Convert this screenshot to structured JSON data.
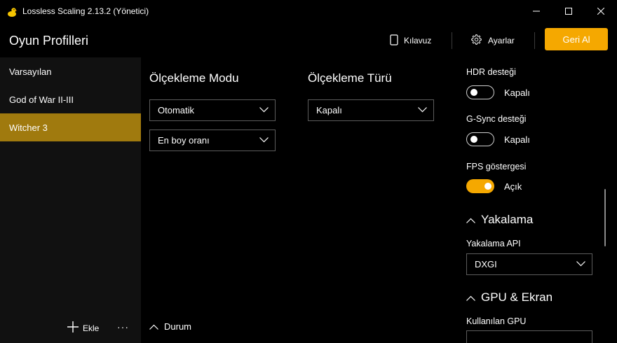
{
  "window": {
    "title": "Lossless Scaling 2.13.2 (Yönetici)",
    "app_icon": "duck-icon",
    "controls": [
      "minimize-icon",
      "maximize-icon",
      "close-icon"
    ]
  },
  "header": {
    "page_title": "Oyun Profilleri",
    "guide_label": "Kılavuz",
    "settings_label": "Ayarlar",
    "revert_label": "Geri Al"
  },
  "sidebar": {
    "items": [
      {
        "label": "Varsayılan",
        "active": false
      },
      {
        "label": "God of War II-III",
        "active": false
      },
      {
        "label": "Witcher 3",
        "active": true
      }
    ],
    "add_label": "Ekle",
    "more_label": "···"
  },
  "main": {
    "scaling_mode": {
      "title": "Ölçekleme Modu",
      "mode_value": "Otomatik",
      "aspect_value": "En boy oranı"
    },
    "scaling_type": {
      "title": "Ölçekleme Türü",
      "value": "Kapalı"
    },
    "status_label": "Durum"
  },
  "right": {
    "hdr": {
      "label": "HDR desteği",
      "state": "Kapalı",
      "on": false
    },
    "gsync": {
      "label": "G-Sync desteği",
      "state": "Kapalı",
      "on": false
    },
    "fps": {
      "label": "FPS göstergesi",
      "state": "Açık",
      "on": true
    },
    "capture": {
      "title": "Yakalama",
      "api_label": "Yakalama API",
      "api_value": "DXGI"
    },
    "gpu": {
      "title": "GPU & Ekran",
      "gpu_label": "Kullanılan GPU"
    }
  },
  "colors": {
    "accent": "#f5a800",
    "active_item": "#a07a0e",
    "sidebar_bg": "#111111",
    "background": "#000000"
  }
}
